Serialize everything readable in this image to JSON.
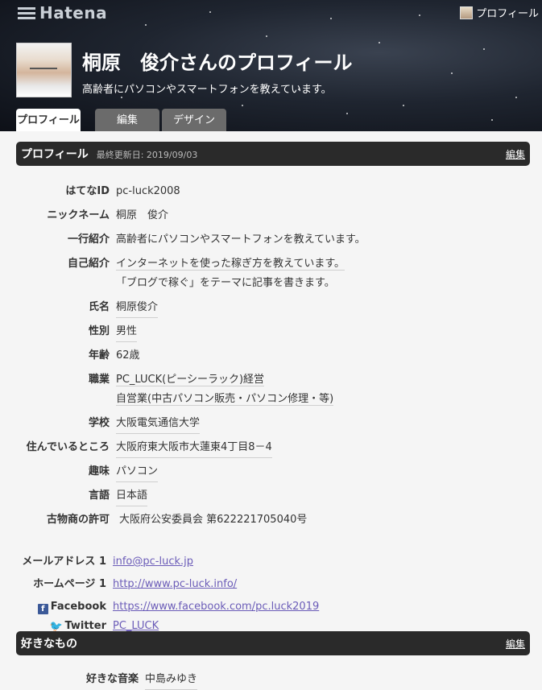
{
  "header": {
    "logo": "Hatena",
    "toplink_label": "プロフィール",
    "title": "桐原　俊介さんのプロフィール",
    "subtitle": "高齢者にパソコンやスマートフォンを教えています。"
  },
  "tabs": [
    {
      "label": "プロフィール",
      "active": true
    },
    {
      "label": "編集"
    },
    {
      "label": "デザイン"
    }
  ],
  "profile_section": {
    "title": "プロフィール",
    "updated": "最終更新日: 2019/09/03",
    "edit": "編集",
    "rows": [
      {
        "label": "はてなID",
        "value": "pc-luck2008"
      },
      {
        "label": "ニックネーム",
        "value": "桐原　俊介"
      },
      {
        "label": "一行紹介",
        "value": "高齢者にパソコンやスマートフォンを教えています。"
      },
      {
        "label": "自己紹介",
        "value": "インターネットを使った稼ぎ方を教えています。",
        "value2": "「ブログで稼ぐ」をテーマに記事を書きます。"
      },
      {
        "label": "氏名",
        "value": "桐原俊介"
      },
      {
        "label": "性別",
        "value": "男性"
      },
      {
        "label": "年齢",
        "value": "62歳"
      },
      {
        "label": "職業",
        "value": "PC_LUCK(ピーシーラック)経営",
        "value2": "自営業(中古パソコン販売・パソコン修理・等)"
      },
      {
        "label": "学校",
        "value": "大阪電気通信大学"
      },
      {
        "label": "住んでいるところ",
        "value": "大阪府東大阪市大蓮東4丁目8－4"
      },
      {
        "label": "趣味",
        "value": "パソコン"
      },
      {
        "label": "言語",
        "value": "日本語"
      },
      {
        "label": "古物商の許可",
        "value": "大阪府公安委員会 第622221705040号"
      }
    ],
    "contacts": [
      {
        "label": "メールアドレス 1",
        "value": "info@pc-luck.jp"
      },
      {
        "label": "ホームページ 1",
        "value": "http://www.pc-luck.info/"
      },
      {
        "label": "Facebook",
        "value": "https://www.facebook.com/pc.luck2019"
      },
      {
        "label": "Twitter",
        "value": "PC_LUCK"
      }
    ]
  },
  "likes_section": {
    "title": "好きなもの",
    "edit": "編集",
    "rows": [
      {
        "label": "好きな音楽",
        "value": "中島みゆき"
      }
    ]
  },
  "colors": {
    "accent": "#2a2a2a",
    "link": "#6b5cb8",
    "facebook": "#3b5998",
    "twitter": "#1da1f2"
  }
}
